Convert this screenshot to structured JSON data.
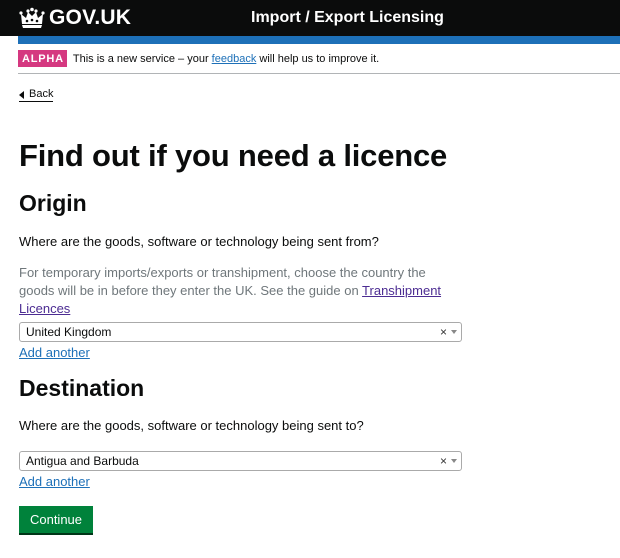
{
  "header": {
    "logo_text": "GOV.UK",
    "service_name": "Import / Export Licensing"
  },
  "phase_banner": {
    "tag": "ALPHA",
    "text_before": "This is a new service – your ",
    "link": "feedback",
    "text_after": " will help us to improve it."
  },
  "back_label": "Back",
  "page_title": "Find out if you need a licence",
  "origin": {
    "heading": "Origin",
    "label": "Where are the goods, software or technology being sent from?",
    "hint_before": "For temporary imports/exports or transhipment, choose the country the goods will be in before they enter the UK. See the guide on ",
    "hint_link": "Transhipment Licences",
    "selected": "United Kingdom",
    "clear": "×",
    "add_another": "Add another"
  },
  "destination": {
    "heading": "Destination",
    "label": "Where are the goods, software or technology being sent to?",
    "selected": "Antigua and Barbuda",
    "clear": "×",
    "add_another": "Add another"
  },
  "continue_label": "Continue",
  "colors": {
    "header_bg": "#0b0c0c",
    "brand_blue": "#1d70b8",
    "alpha_tag": "#d53880",
    "button_green": "#00823b",
    "visited_link": "#4c2c92"
  }
}
